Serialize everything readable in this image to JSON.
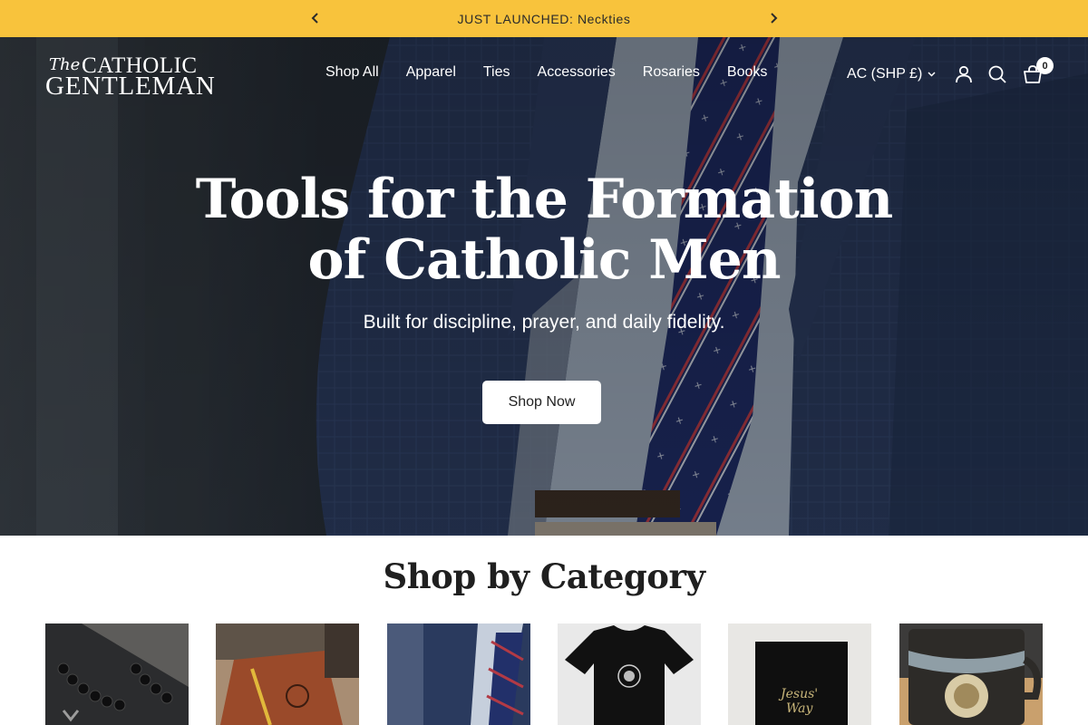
{
  "announcement": {
    "text": "JUST LAUNCHED: Neckties",
    "prev_icon": "chevron-left-icon",
    "next_icon": "chevron-right-icon"
  },
  "brand": {
    "logo_line1_small": "The",
    "logo_line1": "CATHOLIC",
    "logo_line2": "GENTLEMAN"
  },
  "nav": {
    "items": [
      "Shop All",
      "Apparel",
      "Ties",
      "Accessories",
      "Rosaries",
      "Books"
    ]
  },
  "header": {
    "currency": "AC (SHP £)",
    "cart_count": "0",
    "icons": [
      "user-icon",
      "search-icon",
      "cart-icon"
    ]
  },
  "hero": {
    "title": "Tools for the Formation of Catholic Men",
    "subtitle": "Built for discipline, prayer, and daily fidelity.",
    "cta_label": "Shop Now"
  },
  "categories": {
    "title": "Shop by Category",
    "items": [
      "rosary",
      "leather-journal",
      "necktie",
      "t-shirt",
      "book",
      "mug"
    ]
  },
  "colors": {
    "announcement_bg": "#f8c33c",
    "hero_overlay": "#1c222b",
    "text_dark": "#1e1e1e"
  }
}
